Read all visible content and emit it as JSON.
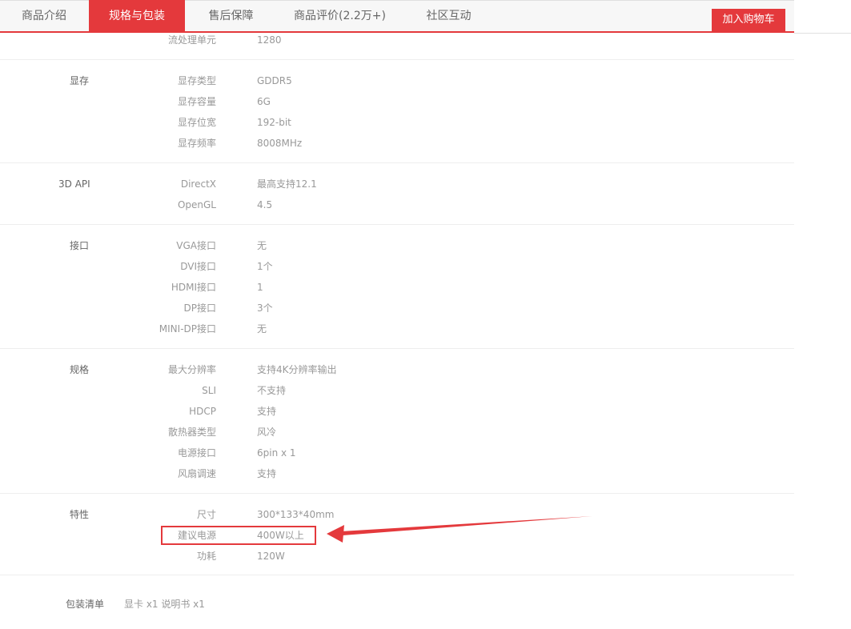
{
  "tabs": [
    {
      "label": "商品介绍",
      "active": false
    },
    {
      "label": "规格与包装",
      "active": true
    },
    {
      "label": "售后保障",
      "active": false
    },
    {
      "label": "商品评价(2.2万+)",
      "active": false
    },
    {
      "label": "社区互动",
      "active": false
    }
  ],
  "cart_button": "加入购物车",
  "specs": {
    "partial_row": {
      "key": "流处理单元",
      "value": "1280"
    },
    "groups": [
      {
        "label": "显存",
        "rows": [
          {
            "key": "显存类型",
            "value": "GDDR5"
          },
          {
            "key": "显存容量",
            "value": "6G"
          },
          {
            "key": "显存位宽",
            "value": "192-bit"
          },
          {
            "key": "显存频率",
            "value": "8008MHz"
          }
        ]
      },
      {
        "label": "3D API",
        "rows": [
          {
            "key": "DirectX",
            "value": "最高支持12.1"
          },
          {
            "key": "OpenGL",
            "value": "4.5"
          }
        ]
      },
      {
        "label": "接口",
        "rows": [
          {
            "key": "VGA接口",
            "value": "无"
          },
          {
            "key": "DVI接口",
            "value": "1个"
          },
          {
            "key": "HDMI接口",
            "value": "1"
          },
          {
            "key": "DP接口",
            "value": "3个"
          },
          {
            "key": "MINI-DP接口",
            "value": "无"
          }
        ]
      },
      {
        "label": "规格",
        "rows": [
          {
            "key": "最大分辨率",
            "value": "支持4K分辨率输出"
          },
          {
            "key": "SLI",
            "value": "不支持"
          },
          {
            "key": "HDCP",
            "value": "支持"
          },
          {
            "key": "散热器类型",
            "value": "风冷"
          },
          {
            "key": "电源接口",
            "value": "6pin x 1"
          },
          {
            "key": "风扇调速",
            "value": "支持"
          }
        ]
      },
      {
        "label": "特性",
        "rows": [
          {
            "key": "尺寸",
            "value": "300*133*40mm"
          },
          {
            "key": "建议电源",
            "value": "400W以上"
          },
          {
            "key": "功耗",
            "value": "120W"
          }
        ]
      }
    ]
  },
  "package": {
    "label": "包装清单",
    "value": "显卡 x1 说明书 x1"
  },
  "colors": {
    "accent": "#e4393c",
    "text_dark": "#666666",
    "text_light": "#999999"
  }
}
